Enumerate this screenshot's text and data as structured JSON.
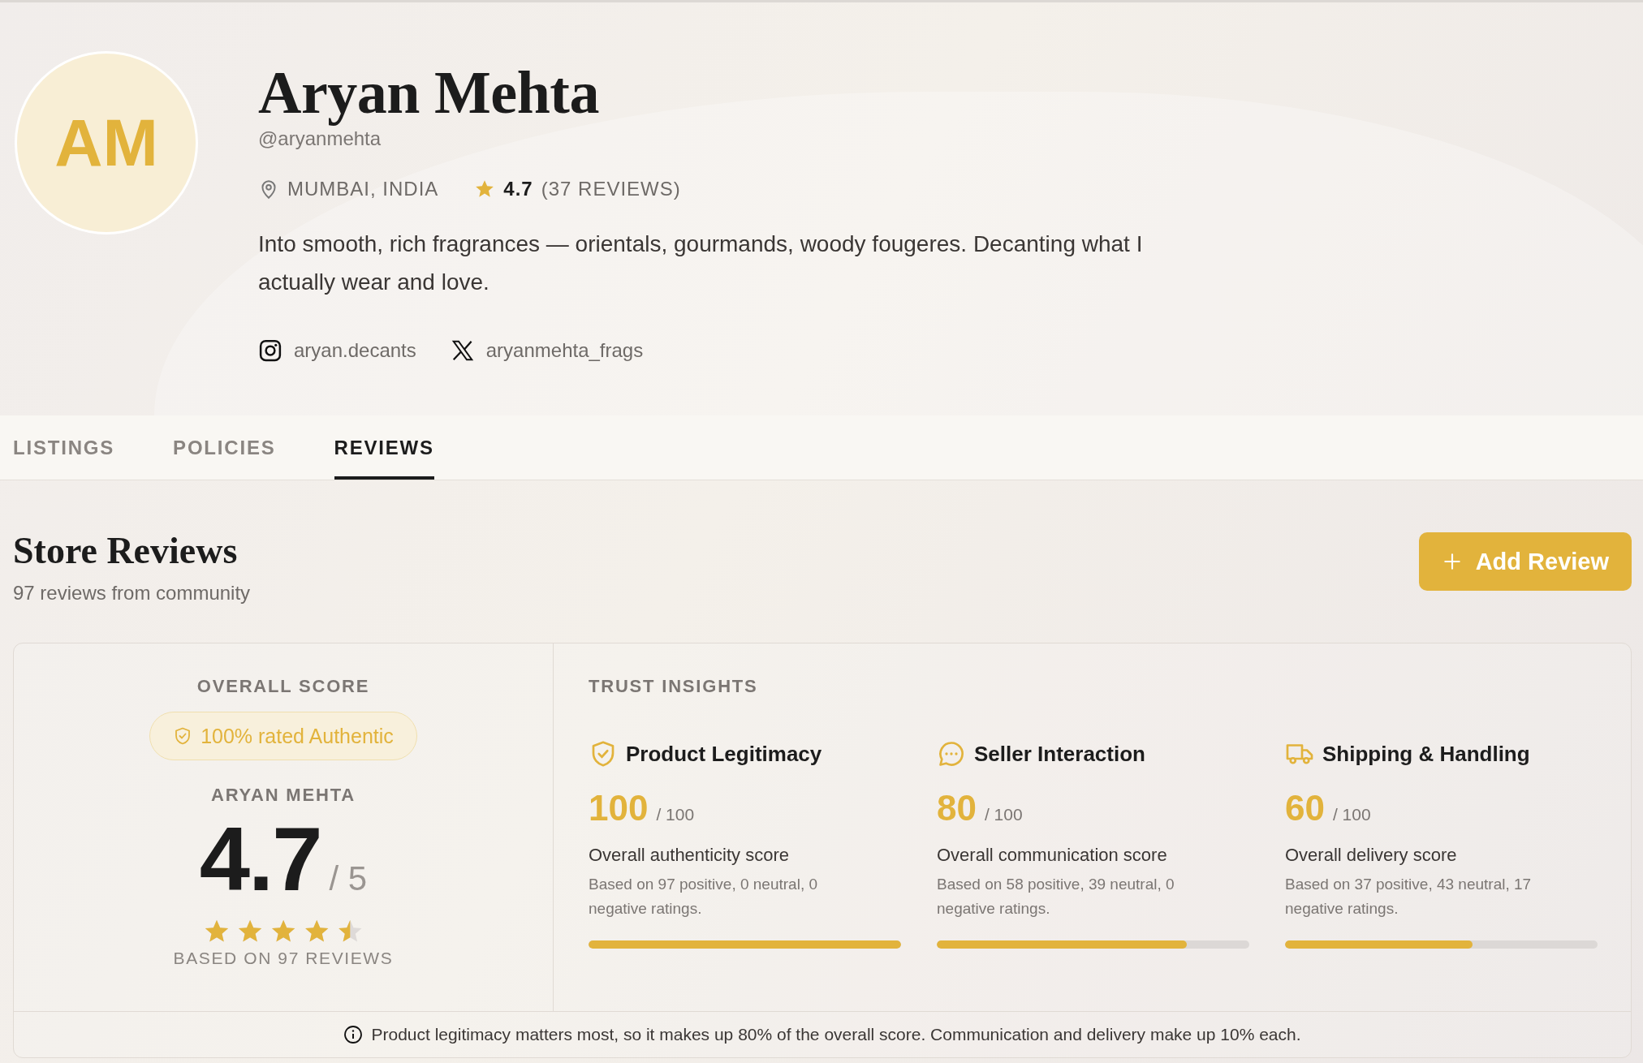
{
  "profile": {
    "initials": "AM",
    "name": "Aryan Mehta",
    "handle": "@aryanmehta",
    "location": "MUMBAI, INDIA",
    "rating": "4.7",
    "review_count": "(37 REVIEWS)",
    "bio": "Into smooth, rich fragrances — orientals, gourmands, woody fougeres. Decanting what I actually wear and love.",
    "socials": [
      {
        "kind": "instagram",
        "handle": "aryan.decants"
      },
      {
        "kind": "x",
        "handle": "aryanmehta_frags"
      }
    ]
  },
  "tabs": [
    {
      "label": "LISTINGS",
      "selected": false
    },
    {
      "label": "POLICIES",
      "selected": false
    },
    {
      "label": "REVIEWS",
      "selected": true
    }
  ],
  "reviews": {
    "title": "Store Reviews",
    "subtitle": "97 reviews from community",
    "add_button": "Add Review"
  },
  "overall": {
    "label": "OVERALL SCORE",
    "badge": "100% rated Authentic",
    "seller": "ARYAN MEHTA",
    "score": "4.7",
    "out_of": "/ 5",
    "stars": 4.5,
    "based_on": "BASED ON 97 REVIEWS"
  },
  "trust": {
    "title": "TRUST INSIGHTS",
    "metrics": [
      {
        "kind": "shield",
        "name": "Product Legitimacy",
        "score": "100",
        "out_of": "/ 100",
        "label": "Overall authenticity score",
        "detail": "Based on 97 positive, 0 neutral, 0 negative ratings.",
        "level": 1.0
      },
      {
        "kind": "chat",
        "name": "Seller Interaction",
        "score": "80",
        "out_of": "/ 100",
        "label": "Overall communication score",
        "detail": "Based on 58 positive, 39 neutral, 0 negative ratings.",
        "level": 0.8
      },
      {
        "kind": "truck",
        "name": "Shipping & Handling",
        "score": "60",
        "out_of": "/ 100",
        "label": "Overall delivery score",
        "detail": "Based on 37 positive, 43 neutral, 17 negative ratings.",
        "level": 0.6
      }
    ]
  },
  "footnote": "Product legitimacy matters most, so it makes up 80% of the overall score. Communication and delivery make up 10% each."
}
